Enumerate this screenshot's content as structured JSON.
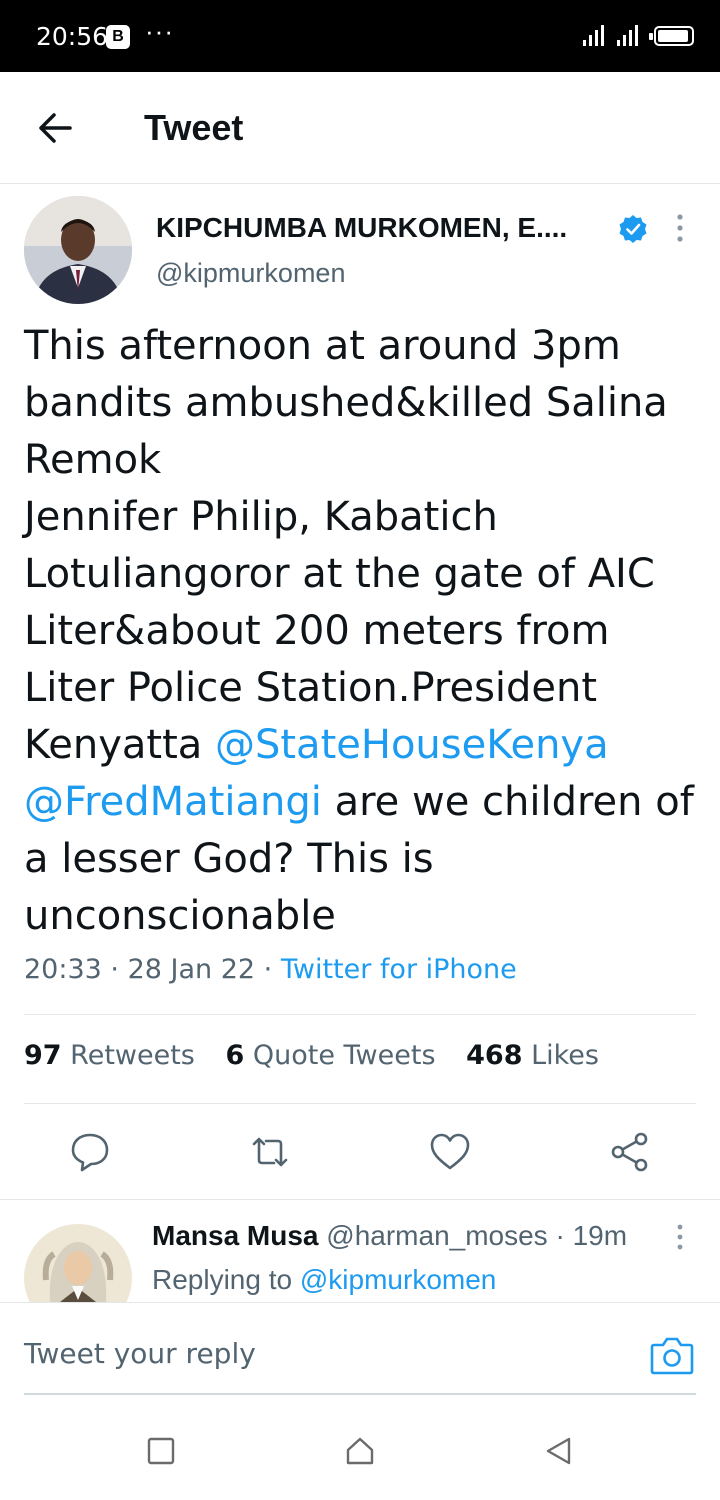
{
  "status_bar": {
    "time": "20:56",
    "app_badge": "B",
    "overflow": "···"
  },
  "header": {
    "title": "Tweet"
  },
  "tweet": {
    "author_name": "KIPCHUMBA MURKOMEN, E....",
    "handle": "@kipmurkomen",
    "verified": true,
    "text_lines": [
      [
        "This afternoon at around 3pm"
      ],
      [
        "bandits ambushed&killed Salina"
      ],
      [
        "Remok"
      ],
      [
        "Jennifer Philip, Kabatich"
      ],
      [
        "Lotuliangoror at the gate of AIC"
      ],
      [
        "Liter&about 200 meters from"
      ],
      [
        "Liter Police Station.President"
      ],
      [
        "Kenyatta ",
        "@StateHouseKenya"
      ],
      [
        "@FredMatiangi",
        " are we children of"
      ],
      [
        "a lesser God? This is"
      ],
      [
        "unconscionable"
      ]
    ],
    "time": "20:33",
    "date": "28 Jan 22",
    "source": "Twitter for iPhone",
    "stats": {
      "retweets_count": "97",
      "retweets_label": "Retweets",
      "quotes_count": "6",
      "quotes_label": "Quote Tweets",
      "likes_count": "468",
      "likes_label": "Likes"
    }
  },
  "reply": {
    "name": "Mansa Musa",
    "handle": "@harman_moses",
    "time": "19m",
    "replying_label": "Replying to",
    "replying_to": "@kipmurkomen"
  },
  "reply_bar": {
    "placeholder": "Tweet your reply"
  },
  "colors": {
    "accent": "#1d9bf0",
    "text": "#0f1419",
    "muted": "#536471"
  }
}
